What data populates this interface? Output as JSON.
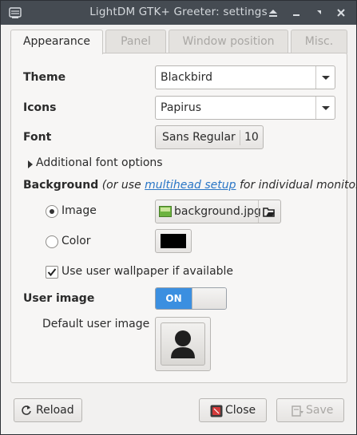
{
  "window": {
    "title": "LightDM GTK+ Greeter: settings",
    "title_color": "#454b52",
    "icon": "app-settings-icon",
    "controls": [
      "minimize-icon",
      "shade-icon",
      "maximize-icon",
      "close-icon"
    ]
  },
  "tabs": [
    {
      "label": "Appearance",
      "active": true
    },
    {
      "label": "Panel",
      "active": false
    },
    {
      "label": "Window position",
      "active": false
    },
    {
      "label": "Misc.",
      "active": false
    }
  ],
  "appearance": {
    "theme": {
      "label": "Theme",
      "value": "Blackbird"
    },
    "icons": {
      "label": "Icons",
      "value": "Papirus"
    },
    "font": {
      "label": "Font",
      "name": "Sans Regular",
      "size": "10"
    },
    "additional_font_options": "Additional font options",
    "background": {
      "label": "Background",
      "hint_before": "(or use ",
      "hint_link": "multihead setup",
      "hint_after": " for individual monitors)",
      "image_option": {
        "label": "Image",
        "selected": true,
        "file": "background.jpg"
      },
      "color_option": {
        "label": "Color",
        "selected": false,
        "color": "#000000"
      },
      "use_user_wallpaper": {
        "label": "Use user wallpaper if available",
        "checked": true
      }
    },
    "user_image": {
      "label": "User image",
      "switch_label": "ON",
      "enabled": true
    },
    "default_user_image": {
      "label": "Default user image",
      "icon": "user-avatar-icon"
    }
  },
  "footer": {
    "reload": "Reload",
    "close": "Close",
    "save": "Save",
    "save_enabled": false
  },
  "colors": {
    "accent": "#3b8fe0",
    "link": "#2a76c6"
  }
}
